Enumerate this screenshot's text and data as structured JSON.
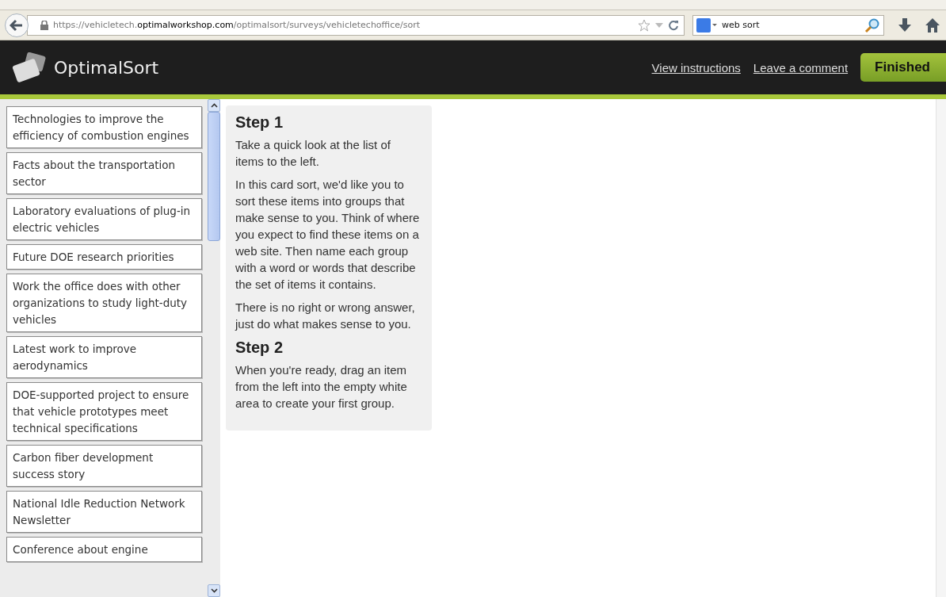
{
  "browser": {
    "url": "https://vehicletech.**optimalworkshop.com**/optimalsort/surveys/vehicletechoffice/sort",
    "search": {
      "value": "web sort"
    }
  },
  "header": {
    "brand": "OptimalSort",
    "links": [
      "View instructions",
      "Leave a comment"
    ],
    "button": "Finished"
  },
  "cards": [
    {
      "text": "Technologies to improve the efficiency of combustion engines"
    },
    {
      "text": "Facts about the transportation sector"
    },
    {
      "text": "Laboratory evaluations of plug-in electric vehicles"
    },
    {
      "text": "Future DOE research priorities"
    },
    {
      "text": "Work the office does with other organizations to study light-duty vehicles"
    },
    {
      "text": "Latest work to improve aerodynamics"
    },
    {
      "text": "DOE-supported project to ensure that vehicle prototypes meet technical specifications"
    },
    {
      "text": "Carbon fiber development success story"
    },
    {
      "text": "National Idle Reduction Network Newsletter"
    },
    {
      "text": "Conference about engine"
    }
  ],
  "instructions": [
    {
      "kind": "heading",
      "text": "Step 1"
    },
    {
      "kind": "paragraph",
      "text": "Take a quick look at the list of items to the left."
    },
    {
      "kind": "paragraph",
      "text": "In this card sort, we'd like you to sort these items into groups that make sense to you. Think of where you expect to find these items on a web site. Then name each group with a word or words that describe the set of items it contains."
    },
    {
      "kind": "paragraph",
      "text": "There is no right or wrong answer, just do what makes sense to you."
    },
    {
      "kind": "heading",
      "text": "Step 2"
    },
    {
      "kind": "paragraph",
      "text": "When you're ready, drag an item from the left into the empty white area to create your first group."
    }
  ]
}
